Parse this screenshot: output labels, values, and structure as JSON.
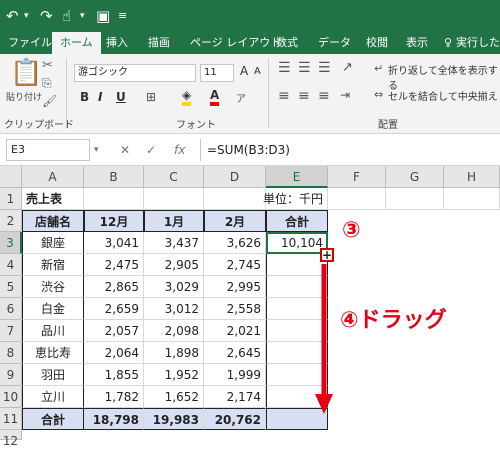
{
  "tabs": [
    "ファイル",
    "ホーム",
    "挿入",
    "描画",
    "ページ レイアウト",
    "数式",
    "データ",
    "校閲",
    "表示",
    "実行したい"
  ],
  "ribbon": {
    "paste": "貼り付け",
    "clipboard_group": "クリップボード",
    "font_name": "游ゴシック",
    "font_size": "11",
    "font_group": "フォント",
    "bold": "B",
    "italic": "I",
    "underline": "U",
    "wrap": "折り返して全体を表示する",
    "merge": "セルを結合して中央揃え",
    "align_group": "配置"
  },
  "formula_bar": {
    "name_box": "E3",
    "fx": "fx",
    "formula": "=SUM(B3:D3)"
  },
  "columns": [
    "A",
    "B",
    "C",
    "D",
    "E",
    "F",
    "G",
    "H"
  ],
  "rows": [
    "1",
    "2",
    "3",
    "4",
    "5",
    "6",
    "7",
    "8",
    "9",
    "10",
    "11",
    "12"
  ],
  "sheet": {
    "title": "売上表",
    "unit": "単位：千円",
    "headers": [
      "店舗名",
      "12月",
      "1月",
      "2月",
      "合計"
    ],
    "data": [
      [
        "銀座",
        "3,041",
        "3,437",
        "3,626",
        "10,104"
      ],
      [
        "新宿",
        "2,475",
        "2,905",
        "2,745",
        ""
      ],
      [
        "渋谷",
        "2,865",
        "3,029",
        "2,995",
        ""
      ],
      [
        "白金",
        "2,659",
        "3,012",
        "2,558",
        ""
      ],
      [
        "品川",
        "2,057",
        "2,098",
        "2,021",
        ""
      ],
      [
        "恵比寿",
        "2,064",
        "1,898",
        "2,645",
        ""
      ],
      [
        "羽田",
        "1,855",
        "1,952",
        "1,999",
        ""
      ],
      [
        "立川",
        "1,782",
        "1,652",
        "2,174",
        ""
      ]
    ],
    "total": [
      "合計",
      "18,798",
      "19,983",
      "20,762",
      ""
    ]
  },
  "annotations": {
    "step3": "③",
    "step4": "④ドラッグ"
  },
  "colors": {
    "excel_green": "#217346",
    "annotation_red": "#e60012",
    "header_fill": "#d9dff3"
  }
}
